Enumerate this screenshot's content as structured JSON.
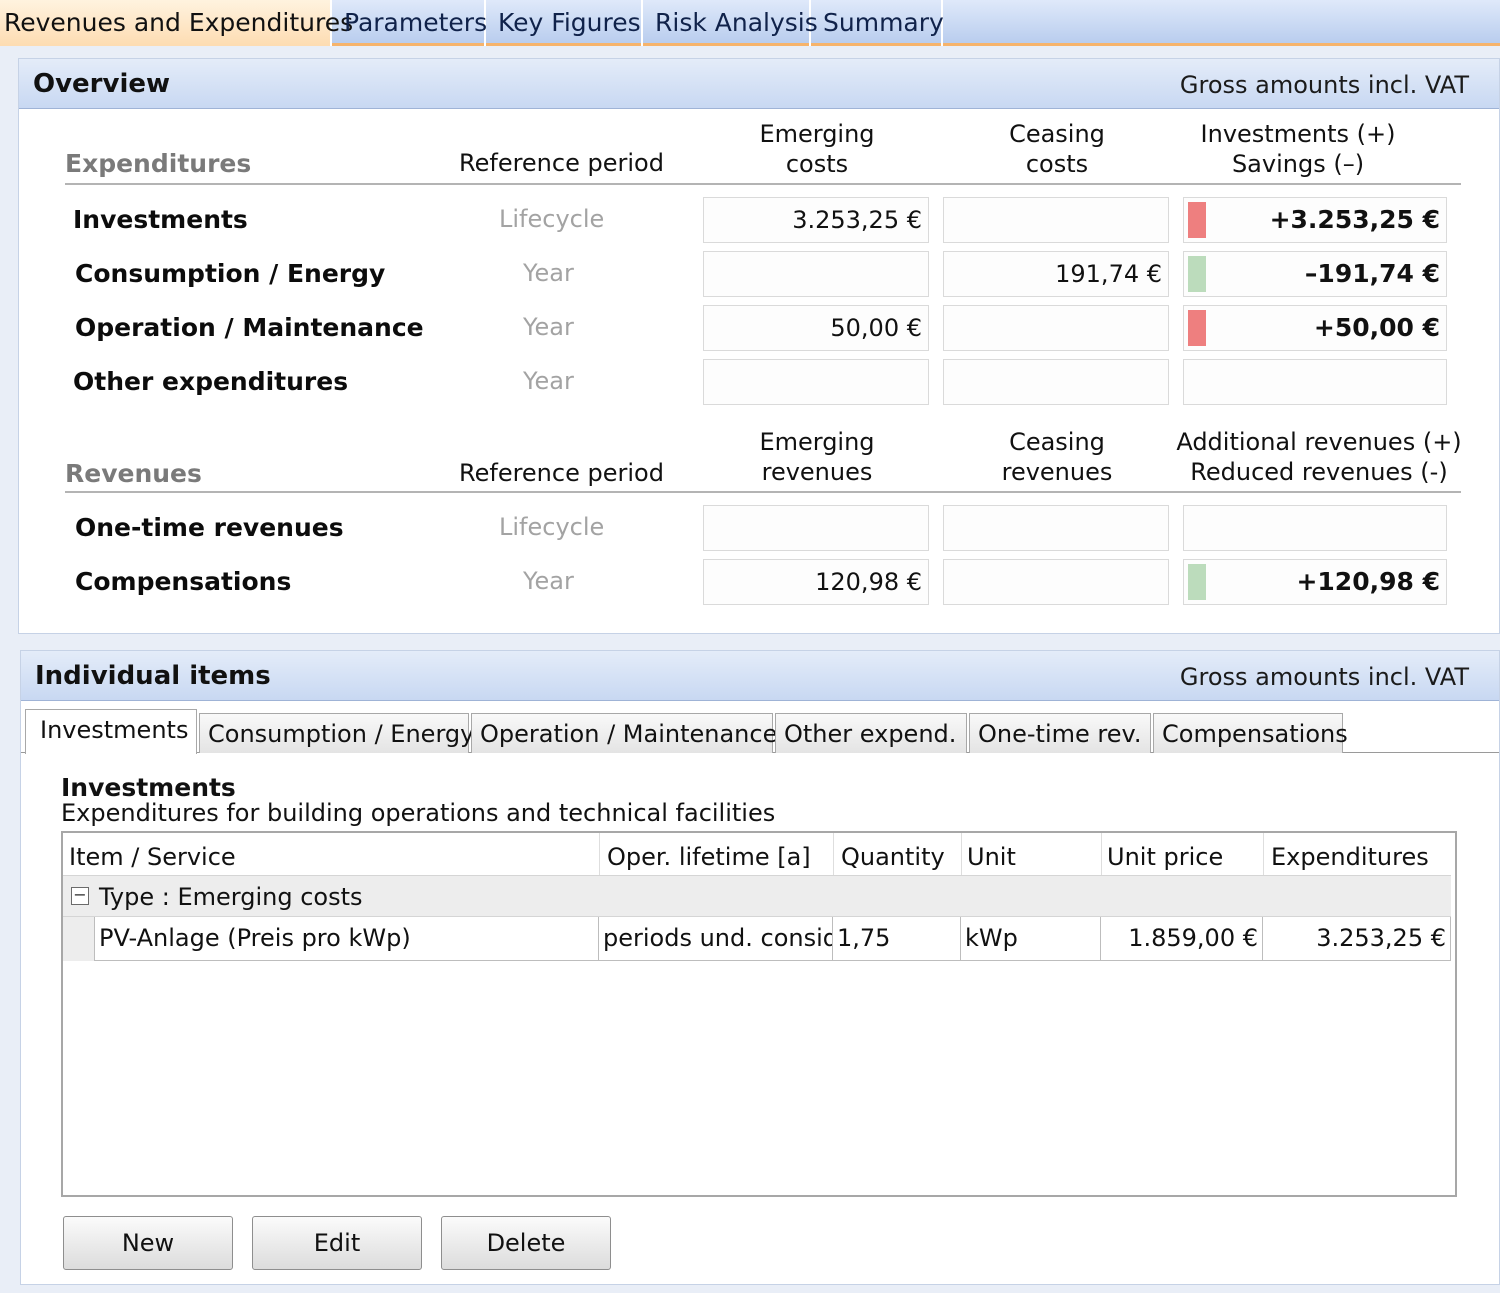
{
  "main_tabs": [
    "Revenues and Expenditures",
    "Parameters",
    "Key Figures",
    "Risk Analysis",
    "Summary"
  ],
  "overview": {
    "title": "Overview",
    "note": "Gross amounts incl. VAT",
    "expenditures": {
      "section_label": "Expenditures",
      "ref_header": "Reference period",
      "col1_header": "Emerging\ncosts",
      "col2_header": "Ceasing\ncosts",
      "col3_header": "Investments (+)\nSavings (–)",
      "rows": [
        {
          "label": "Investments",
          "ref": "Lifecycle",
          "c1": "3.253,25 €",
          "c2": "",
          "result": "+3.253,25 €",
          "indicator": "#ee7f7f"
        },
        {
          "label": "Consumption / Energy",
          "ref": "Year",
          "c1": "",
          "c2": "191,74 €",
          "result": "–191,74 €",
          "indicator": "#bcdcbc"
        },
        {
          "label": "Operation / Maintenance",
          "ref": "Year",
          "c1": "50,00 €",
          "c2": "",
          "result": "+50,00 €",
          "indicator": "#ee7f7f"
        },
        {
          "label": "Other expenditures",
          "ref": "Year",
          "c1": "",
          "c2": "",
          "result": "",
          "indicator": ""
        }
      ]
    },
    "revenues": {
      "section_label": "Revenues",
      "ref_header": "Reference period",
      "col1_header": "Emerging\nrevenues",
      "col2_header": "Ceasing\nrevenues",
      "col3_header": "Additional revenues (+)\nReduced revenues (-)",
      "rows": [
        {
          "label": "One-time revenues",
          "ref": "Lifecycle",
          "c1": "",
          "c2": "",
          "result": "",
          "indicator": ""
        },
        {
          "label": "Compensations",
          "ref": "Year",
          "c1": "120,98 €",
          "c2": "",
          "result": "+120,98 €",
          "indicator": "#bcdcbc"
        }
      ]
    }
  },
  "items": {
    "title": "Individual items",
    "note": "Gross amounts incl. VAT",
    "tabs": [
      "Investments",
      "Consumption / Energy",
      "Operation / Maintenance",
      "Other expend.",
      "One-time rev.",
      "Compensations"
    ],
    "section_heading": "Investments",
    "section_sub": "Expenditures for building operations and technical facilities",
    "grid": {
      "headers": [
        "Item / Service",
        "Oper. lifetime [a]",
        "Quantity",
        "Unit",
        "Unit price",
        "Expenditures"
      ],
      "group_label": "Type : Emerging costs",
      "collapse_glyph": "−",
      "rows": [
        {
          "item": "PV-Anlage (Preis pro kWp)",
          "lifetime": "periods und. consid.",
          "quantity": "1,75",
          "unit": "kWp",
          "unit_price": "1.859,00 €",
          "expenditures": "3.253,25 €"
        }
      ]
    },
    "buttons": {
      "new": "New",
      "edit": "Edit",
      "delete": "Delete"
    }
  }
}
